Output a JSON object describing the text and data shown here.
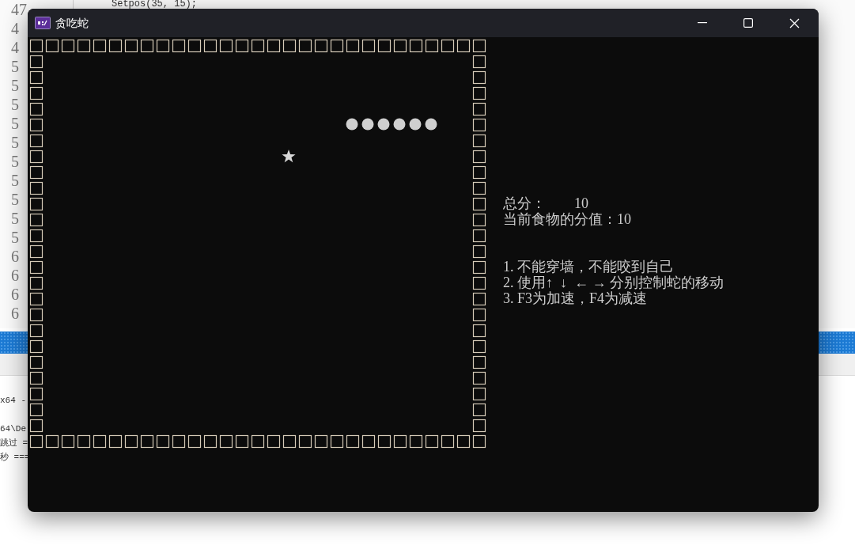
{
  "desktop": {
    "editor": {
      "code_line": "Setpos(35, 15);",
      "line_numbers": [
        "47",
        "4",
        "4",
        "5",
        "5",
        "5",
        "5",
        "5",
        "5",
        "5",
        "5",
        "5",
        "5",
        "6",
        "6",
        "6",
        "6"
      ]
    },
    "output_panel": {
      "lines": [
        "x64 -",
        "64\\De",
        "跳过 =",
        "秒 ==="
      ]
    }
  },
  "window": {
    "title": "贪吃蛇"
  },
  "game": {
    "score": {
      "label": "总分：",
      "value": "10"
    },
    "food_value": "当前食物的分值：10",
    "instructions": [
      "1. 不能穿墙，不能咬到自己",
      "2. 使用↑  ↓  ← → 分别控制蛇的移动",
      "3. F3为加速，F4为减速"
    ]
  }
}
